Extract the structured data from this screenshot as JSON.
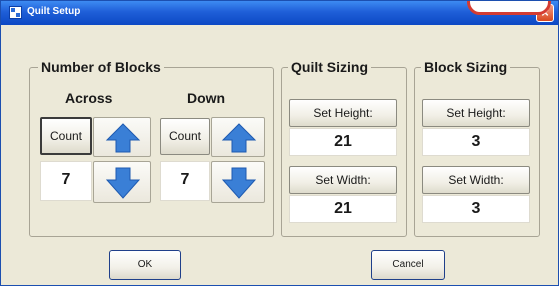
{
  "window": {
    "title": "Quilt Setup",
    "close_glyph": "×",
    "close_icon": "close-icon",
    "app_icon": "quilt-app-icon"
  },
  "number_of_blocks": {
    "title": "Number of Blocks",
    "across": {
      "label": "Across",
      "count_label": "Count",
      "value": "7",
      "up_icon": "arrow-up-icon",
      "down_icon": "arrow-down-icon"
    },
    "down": {
      "label": "Down",
      "count_label": "Count",
      "value": "7",
      "up_icon": "arrow-up-icon",
      "down_icon": "arrow-down-icon"
    }
  },
  "quilt_sizing": {
    "title": "Quilt Sizing",
    "set_height_label": "Set Height:",
    "height_value": "21",
    "set_width_label": "Set Width:",
    "width_value": "21"
  },
  "block_sizing": {
    "title": "Block Sizing",
    "set_height_label": "Set Height:",
    "height_value": "3",
    "set_width_label": "Set Width:",
    "width_value": "3"
  },
  "buttons": {
    "ok": "OK",
    "cancel": "Cancel"
  },
  "colors": {
    "titlebar": "#1f5fd8",
    "dialog_bg": "#ece9d8",
    "arrow_blue": "#3a7fd6",
    "close_red": "#d8471e"
  }
}
